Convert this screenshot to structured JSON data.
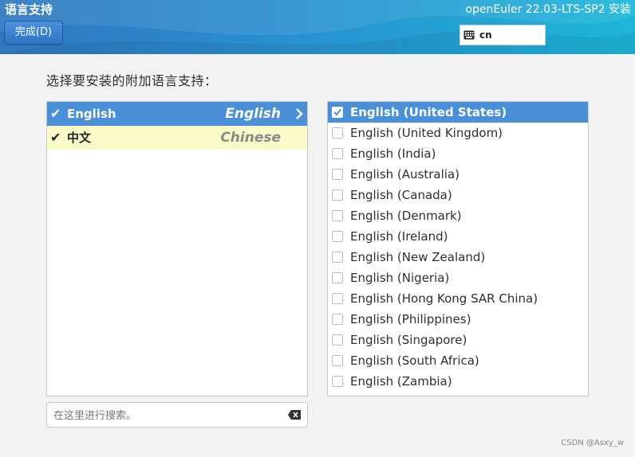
{
  "header": {
    "title": "语言支持",
    "done_label": "完成(D)",
    "product": "openEuler 22.03-LTS-SP2 安装",
    "keyboard_layout": "cn"
  },
  "prompt": "选择要安装的附加语言支持：",
  "languages": [
    {
      "native": "English",
      "english": "English",
      "checked": true,
      "selected": true
    },
    {
      "native": "中文",
      "english": "Chinese",
      "checked": true,
      "selected": false
    }
  ],
  "search": {
    "placeholder": "在这里进行搜索。",
    "value": ""
  },
  "locales": [
    {
      "label": "English (United States)",
      "checked": true,
      "selected": true
    },
    {
      "label": "English (United Kingdom)",
      "checked": false
    },
    {
      "label": "English (India)",
      "checked": false
    },
    {
      "label": "English (Australia)",
      "checked": false
    },
    {
      "label": "English (Canada)",
      "checked": false
    },
    {
      "label": "English (Denmark)",
      "checked": false
    },
    {
      "label": "English (Ireland)",
      "checked": false
    },
    {
      "label": "English (New Zealand)",
      "checked": false
    },
    {
      "label": "English (Nigeria)",
      "checked": false
    },
    {
      "label": "English (Hong Kong SAR China)",
      "checked": false
    },
    {
      "label": "English (Philippines)",
      "checked": false
    },
    {
      "label": "English (Singapore)",
      "checked": false
    },
    {
      "label": "English (South Africa)",
      "checked": false
    },
    {
      "label": "English (Zambia)",
      "checked": false
    }
  ],
  "watermark": "CSDN @Asxy_w",
  "colors": {
    "accent": "#4a90d9",
    "marked_row": "#fafac8",
    "header_start": "#2f78bf",
    "header_end": "#1db6d8"
  },
  "icons": {
    "keyboard": "keyboard-icon",
    "check": "check-icon",
    "arrow": "chevron-right-icon",
    "clear": "clear-icon"
  }
}
